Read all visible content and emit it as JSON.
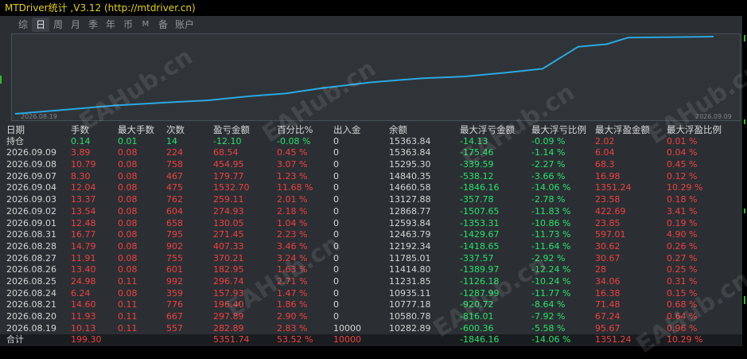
{
  "title": "MTDriver统计 ,V3.12 (http://mtdriver.cn)",
  "tabs": [
    "综",
    "日",
    "周",
    "月",
    "季",
    "年",
    "币",
    "M",
    "备",
    "账户"
  ],
  "active_tab": "日",
  "equity_chart": {
    "start_date": "2026.08.19",
    "end_date": "2026.09.09",
    "line_color": "#2aa8e0",
    "dates": [
      "2026.08.19",
      "2026.08.20",
      "2026.08.21",
      "2026.08.24",
      "2026.08.25",
      "2026.08.26",
      "2026.08.27",
      "2026.08.28",
      "2026.08.31",
      "2026.09.01",
      "2026.09.02",
      "2026.09.03",
      "2026.09.04",
      "2026.09.07",
      "2026.09.08",
      "2026.09.09"
    ],
    "balance": [
      10000,
      10282.89,
      10580.78,
      10777.18,
      10935.11,
      11231.85,
      11414.8,
      11785.01,
      12192.34,
      12463.79,
      12593.84,
      12868.77,
      13127.88,
      14660.58,
      14840.35,
      15295.3,
      15363.84
    ]
  },
  "headers": [
    "日期",
    "手数",
    "最大手数",
    "次数",
    "盈亏金额",
    "百分比%",
    "出入金",
    "余额",
    "最大浮亏金额",
    "最大浮亏比例",
    "最大浮盈金额",
    "最大浮盈比例"
  ],
  "position_row": [
    "持仓",
    "0.14",
    "0.01",
    "14",
    "-12.10",
    "-0.08 %",
    "0",
    "15363.84",
    "-14.13",
    "-0.09 %",
    "2.02",
    "0.01 %"
  ],
  "rows": [
    [
      "2026.09.09",
      "3.89",
      "0.08",
      "224",
      "68.54",
      "0.45 %",
      "0",
      "15363.84",
      "-175.46",
      "-1.14 %",
      "6.04",
      "0.04 %"
    ],
    [
      "2026.09.08",
      "10.79",
      "0.08",
      "758",
      "454.95",
      "3.07 %",
      "0",
      "15295.30",
      "-339.59",
      "-2.27 %",
      "68.3",
      "0.45 %"
    ],
    [
      "2026.09.07",
      "8.30",
      "0.08",
      "467",
      "179.77",
      "1.23 %",
      "0",
      "14840.35",
      "-538.12",
      "-3.66 %",
      "16.98",
      "0.12 %"
    ],
    [
      "2026.09.04",
      "12.04",
      "0.08",
      "475",
      "1532.70",
      "11.68 %",
      "0",
      "14660.58",
      "-1846.16",
      "-14.06 %",
      "1351.24",
      "10.29 %"
    ],
    [
      "2026.09.03",
      "13.37",
      "0.08",
      "762",
      "259.11",
      "2.01 %",
      "0",
      "13127.88",
      "-357.78",
      "-2.78 %",
      "23.58",
      "0.18 %"
    ],
    [
      "2026.09.02",
      "13.54",
      "0.08",
      "604",
      "274.93",
      "2.18 %",
      "0",
      "12868.77",
      "-1507.65",
      "-11.83 %",
      "422.69",
      "3.41 %"
    ],
    [
      "2026.09.01",
      "12.48",
      "0.08",
      "658",
      "130.05",
      "1.04 %",
      "0",
      "12593.84",
      "-1353.31",
      "-10.86 %",
      "23.85",
      "0.19 %"
    ],
    [
      "2026.08.31",
      "16.77",
      "0.08",
      "795",
      "271.45",
      "2.23 %",
      "0",
      "12463.79",
      "-1429.67",
      "-11.73 %",
      "597.01",
      "4.90 %"
    ],
    [
      "2026.08.28",
      "14.79",
      "0.08",
      "902",
      "407.33",
      "3.46 %",
      "0",
      "12192.34",
      "-1418.65",
      "-11.64 %",
      "30.62",
      "0.26 %"
    ],
    [
      "2026.08.27",
      "11.91",
      "0.08",
      "755",
      "370.21",
      "3.24 %",
      "0",
      "11785.01",
      "-337.57",
      "-2.92 %",
      "30.67",
      "0.27 %"
    ],
    [
      "2026.08.26",
      "13.40",
      "0.08",
      "601",
      "182.95",
      "1.63 %",
      "0",
      "11414.80",
      "-1389.97",
      "-12.24 %",
      "28",
      "0.25 %"
    ],
    [
      "2026.08.25",
      "24.98",
      "0.11",
      "992",
      "296.74",
      "2.71 %",
      "0",
      "11231.85",
      "-1126.18",
      "-10.24 %",
      "34.06",
      "0.31 %"
    ],
    [
      "2026.08.24",
      "6.24",
      "0.08",
      "359",
      "157.93",
      "1.47 %",
      "0",
      "10935.11",
      "-1287.99",
      "-11.77 %",
      "16.38",
      "0.15 %"
    ],
    [
      "2026.08.21",
      "14.60",
      "0.11",
      "776",
      "196.40",
      "1.86 %",
      "0",
      "10777.18",
      "-920.72",
      "-8.64 %",
      "71.48",
      "0.68 %"
    ],
    [
      "2026.08.20",
      "11.93",
      "0.11",
      "667",
      "297.89",
      "2.90 %",
      "0",
      "10580.78",
      "-816.01",
      "-7.92 %",
      "67.24",
      "0.64 %"
    ],
    [
      "2026.08.19",
      "10.13",
      "0.11",
      "557",
      "282.89",
      "2.83 %",
      "10000",
      "10282.89",
      "-600.36",
      "-5.58 %",
      "95.67",
      "0.96 %"
    ]
  ],
  "total_row": [
    "合计",
    "199.30",
    "",
    "",
    "5351.74",
    "53.52 %",
    "10000",
    "",
    "-1846.16",
    "-14.06 %",
    "1351.24",
    "10.29 %"
  ],
  "watermark_text": "EAHub.cn"
}
